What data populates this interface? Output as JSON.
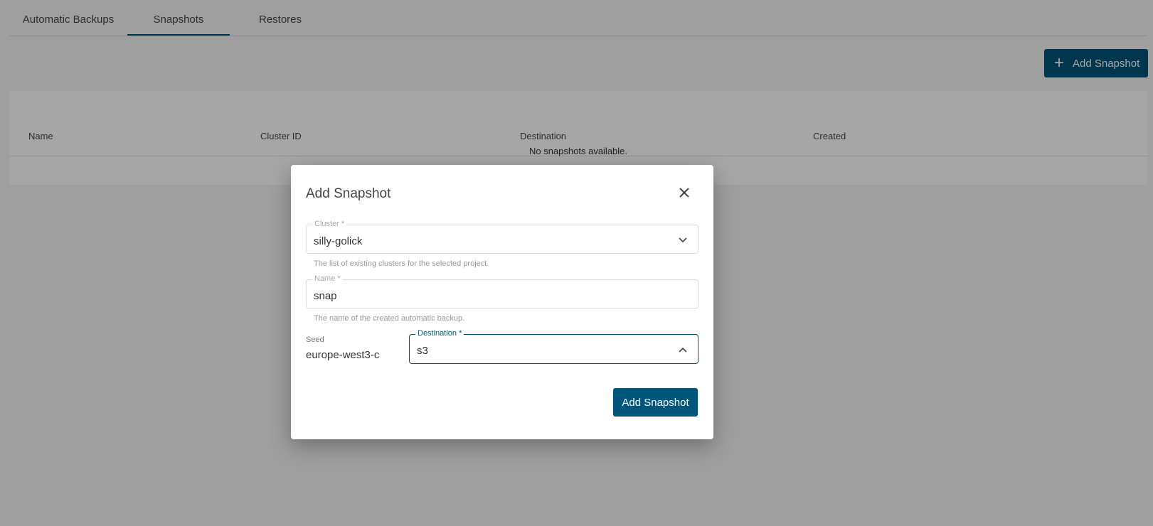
{
  "tabs": [
    {
      "label": "Automatic Backups",
      "active": false
    },
    {
      "label": "Snapshots",
      "active": true
    },
    {
      "label": "Restores",
      "active": false
    }
  ],
  "toolbar": {
    "add_snapshot_label": "Add Snapshot",
    "add_icon": "plus-icon"
  },
  "table": {
    "columns": [
      "Name",
      "Cluster ID",
      "Destination",
      "Created"
    ],
    "empty_message": "No snapshots available."
  },
  "dialog": {
    "title": "Add Snapshot",
    "close_icon": "close-icon",
    "cluster": {
      "label": "Cluster *",
      "value": "silly-golick",
      "hint": "The list of existing clusters for the selected project."
    },
    "name": {
      "label": "Name *",
      "value": "snap",
      "hint": "The name of the created automatic backup."
    },
    "seed": {
      "label": "Seed",
      "value": "europe-west3-c"
    },
    "destination": {
      "label": "Destination *",
      "value": "s3"
    },
    "submit_label": "Add Snapshot"
  },
  "colors": {
    "primary": "#00557a",
    "active_tab_underline": "#004a6b"
  }
}
